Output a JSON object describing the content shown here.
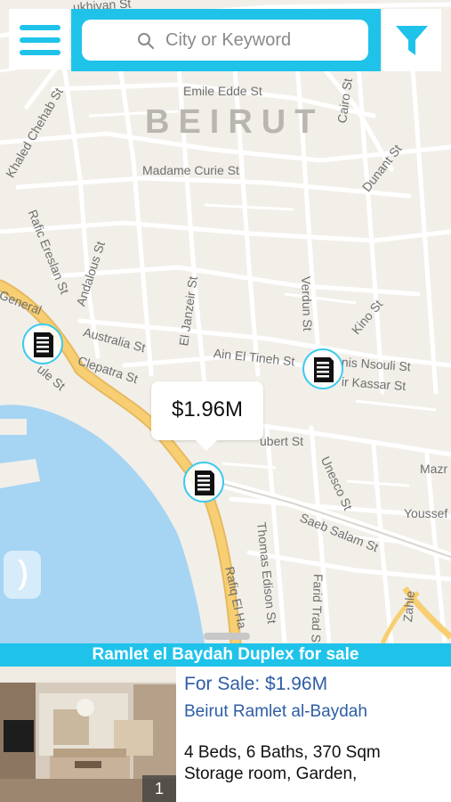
{
  "search": {
    "placeholder": "City or Keyword"
  },
  "icons": {
    "menu": "hamburger-menu-icon",
    "search": "magnifier-icon",
    "filter": "funnel-icon",
    "marker": "building-icon",
    "side_handle": "chevron-icon"
  },
  "colors": {
    "accent": "#1fc3ea",
    "link": "#2e5da5",
    "water": "#a6d4f3",
    "highway": "#f7cf72",
    "land": "#f2efe9"
  },
  "map": {
    "city": "BEIRUT",
    "streets": {
      "s1": "Emile Edde St",
      "s2": "Cairo St",
      "s3": "Khaled Chehab St",
      "s4": "Madame Curie St",
      "s5": "Dunant St",
      "s6": "Rafic Ereslan St",
      "s7": "Andalous St",
      "s8": "Verdun St",
      "s9": "Kino St",
      "s10": "General",
      "s11": "ule St",
      "s12": "Australia St",
      "s13": "Clepatra St",
      "s14": "El Janzeir St",
      "s15": "Ain El Tineh St",
      "s16": "nis Nsouli St",
      "s17": "ir Kassar St",
      "s18": "ubert St",
      "s19": "Unesco St",
      "s20": "Mazr",
      "s21": "Youssef",
      "s22": "Saeb Salam St",
      "s23": "Thomas Edison St",
      "s24": "Rafiq El Ha",
      "s25": "Farid Trad St",
      "s26": "ukhiyan St",
      "s27": "Zahle"
    },
    "callout_price": "$1.96M"
  },
  "listing": {
    "title": "Ramlet el Baydah Duplex for sale",
    "price": "For Sale: $1.96M",
    "location": "Beirut Ramlet al-Baydah",
    "details": "4 Beds, 6 Baths, 370 Sqm",
    "features": "Storage room, Garden,",
    "photo_index": "1"
  }
}
